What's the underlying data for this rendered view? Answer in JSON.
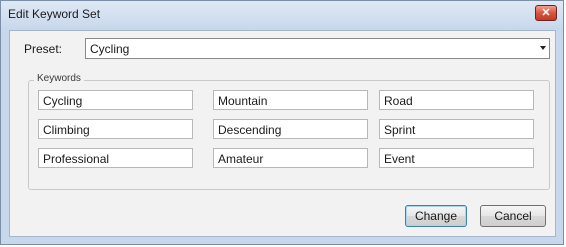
{
  "window": {
    "title": "Edit Keyword Set",
    "close_icon": "close-icon",
    "close_glyph": "✕"
  },
  "preset": {
    "label": "Preset:",
    "value": "Cycling"
  },
  "keywords": {
    "legend": "Keywords",
    "rows": [
      [
        "Cycling",
        "Mountain",
        "Road"
      ],
      [
        "Climbing",
        "Descending",
        "Sprint"
      ],
      [
        "Professional",
        "Amateur",
        "Event"
      ]
    ]
  },
  "buttons": {
    "change": "Change",
    "cancel": "Cancel"
  },
  "colors": {
    "close_button": "#c23c27",
    "default_button_border": "#3c7fb1"
  }
}
